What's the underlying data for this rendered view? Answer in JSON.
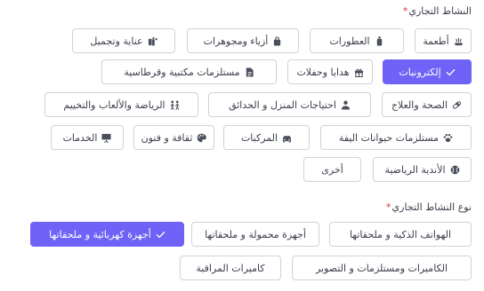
{
  "business_activity": {
    "title": "النشاط التجاري",
    "required_mark": "*",
    "options": [
      {
        "label": "أطعمة",
        "icon": "food-icon"
      },
      {
        "label": "العطورات",
        "icon": "perfume-icon"
      },
      {
        "label": "أزياء ومجوهرات",
        "icon": "bag-icon"
      },
      {
        "label": "عناية وتجميل",
        "icon": "beauty-icon"
      },
      {
        "label": "إلكترونيات",
        "icon": "check-icon",
        "selected": true
      },
      {
        "label": "هدايا وحفلات",
        "icon": "gift-icon"
      },
      {
        "label": "مستلزمات مكتبية وقرطاسية",
        "icon": "document-icon"
      },
      {
        "label": "الصحة والعلاج",
        "icon": "pill-icon"
      },
      {
        "label": "احتياجات المنزل و الحدائق",
        "icon": "home-garden-icon"
      },
      {
        "label": "الرياضة والألعاب والتخييم",
        "icon": "sports-icon"
      },
      {
        "label": "مستلزمات حيوانات اليفة",
        "icon": "paw-icon"
      },
      {
        "label": "المركبات",
        "icon": "car-icon"
      },
      {
        "label": "ثقافة و فنون",
        "icon": "palette-icon"
      },
      {
        "label": "الخدمات",
        "icon": "presentation-icon"
      },
      {
        "label": "الأندية الرياضية",
        "icon": "ball-icon"
      },
      {
        "label": "أخرى",
        "icon": ""
      }
    ]
  },
  "business_activity_type": {
    "title": "نوع النشاط التجاري",
    "required_mark": "*",
    "options": [
      {
        "label": "الهواتف الذكية و ملحقاتها",
        "icon": ""
      },
      {
        "label": "أجهزة محمولة و ملحقاتها",
        "icon": ""
      },
      {
        "label": "أجهزة كهربائية و ملحقاتها",
        "icon": "check-icon",
        "selected": true
      },
      {
        "label": "الكاميرات ومستلزمات و التصوير",
        "icon": ""
      },
      {
        "label": "كاميرات المراقبة",
        "icon": ""
      }
    ]
  },
  "colors": {
    "accent": "#6e63f6",
    "border": "#cfd2db",
    "text": "#3b3f4a",
    "required": "#d23b3b"
  }
}
